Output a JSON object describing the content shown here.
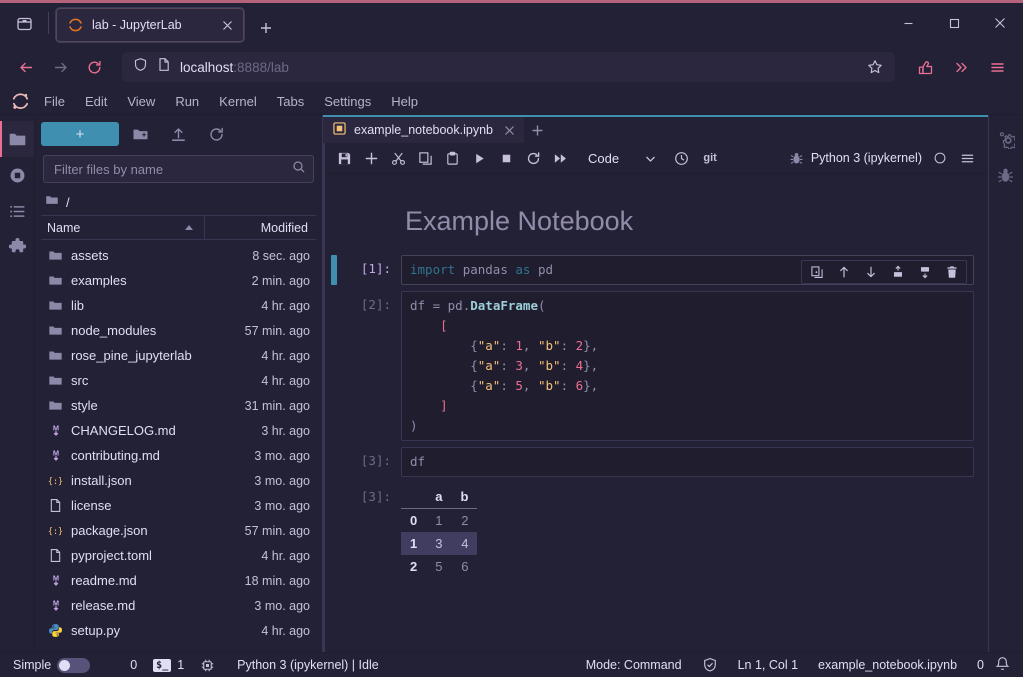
{
  "browser": {
    "tab": {
      "title": "lab - JupyterLab",
      "favicon": "jupyter-icon",
      "close": "close-icon"
    },
    "new_tab_label": "+",
    "url_display": "localhost",
    "url_rest": ":8888/lab",
    "list_all_tabs_icon": "tab-list-icon",
    "nav": {
      "back": "back-arrow-icon",
      "forward": "forward-arrow-icon",
      "reload": "reload-icon",
      "shield": "shield-icon",
      "page": "page-icon",
      "bookmark": "star-icon",
      "extensions": "extension-icon",
      "overflow": "chevron-double-right-icon",
      "menu": "hamburger-menu-icon"
    },
    "window_controls": {
      "minimize": "minimize-icon",
      "maximize": "maximize-icon",
      "close": "close-icon"
    }
  },
  "jupyter": {
    "logo": "jupyter-logo-icon",
    "menus": [
      "File",
      "Edit",
      "View",
      "Run",
      "Kernel",
      "Tabs",
      "Settings",
      "Help"
    ],
    "activity_bar": [
      {
        "name": "file-browser",
        "icon": "folder-icon",
        "active": true
      },
      {
        "name": "running-terminals",
        "icon": "running-circle-icon",
        "active": false
      },
      {
        "name": "table-of-contents",
        "icon": "list-icon",
        "active": false
      },
      {
        "name": "extension-manager",
        "icon": "puzzle-icon",
        "active": false
      }
    ],
    "right_bar": [
      {
        "name": "property-inspector",
        "icon": "gears-icon"
      },
      {
        "name": "debugger",
        "icon": "bug-icon"
      }
    ],
    "file_browser": {
      "new_launcher_label": "+",
      "toolbar": [
        "new-folder-icon",
        "upload-icon",
        "refresh-icon"
      ],
      "filter_placeholder": "Filter files by name",
      "filter_value": "",
      "search_icon": "search-icon",
      "breadcrumb": "/",
      "columns": {
        "name": "Name",
        "modified": "Modified",
        "sort": "sort-ascending-icon"
      },
      "files": [
        {
          "name": "assets",
          "modified": "8 sec. ago",
          "type": "folder"
        },
        {
          "name": "examples",
          "modified": "2 min. ago",
          "type": "folder"
        },
        {
          "name": "lib",
          "modified": "4 hr. ago",
          "type": "folder"
        },
        {
          "name": "node_modules",
          "modified": "57 min. ago",
          "type": "folder"
        },
        {
          "name": "rose_pine_jupyterlab",
          "modified": "4 hr. ago",
          "type": "folder"
        },
        {
          "name": "src",
          "modified": "4 hr. ago",
          "type": "folder"
        },
        {
          "name": "style",
          "modified": "31 min. ago",
          "type": "folder"
        },
        {
          "name": "CHANGELOG.md",
          "modified": "3 hr. ago",
          "type": "markdown"
        },
        {
          "name": "contributing.md",
          "modified": "3 mo. ago",
          "type": "markdown"
        },
        {
          "name": "install.json",
          "modified": "3 mo. ago",
          "type": "json"
        },
        {
          "name": "license",
          "modified": "3 mo. ago",
          "type": "file"
        },
        {
          "name": "package.json",
          "modified": "57 min. ago",
          "type": "json"
        },
        {
          "name": "pyproject.toml",
          "modified": "4 hr. ago",
          "type": "file"
        },
        {
          "name": "readme.md",
          "modified": "18 min. ago",
          "type": "markdown"
        },
        {
          "name": "release.md",
          "modified": "3 mo. ago",
          "type": "markdown"
        },
        {
          "name": "setup.py",
          "modified": "4 hr. ago",
          "type": "python"
        }
      ]
    },
    "notebook": {
      "tab_label": "example_notebook.ipynb",
      "tab_icon": "notebook-icon",
      "tab_close": "close-icon",
      "add_tab": "+",
      "toolbar": {
        "save": "save-icon",
        "insert": "plus-icon",
        "cut": "scissors-icon",
        "copy": "copy-icon",
        "paste": "paste-icon",
        "run": "play-icon",
        "stop": "stop-icon",
        "restart": "restart-icon",
        "restart_run_all": "fast-forward-icon",
        "cell_type": "Code",
        "cell_type_chevron": "chevron-down-icon",
        "history": "clock-icon",
        "git": "git",
        "debugger": "bug-icon",
        "kernel_name": "Python 3 (ipykernel)",
        "kernel_status": "circle-idle-icon",
        "kernel_menu": "hamburger-menu-icon"
      },
      "title": "Example Notebook",
      "cells": [
        {
          "prompt": "[1]:",
          "active": true,
          "toolbar": [
            "duplicate-icon",
            "move-up-icon",
            "move-down-icon",
            "insert-above-icon",
            "insert-below-icon",
            "delete-icon"
          ],
          "code_html": "<span class=\"k\">import</span> <span class=\"id\">pandas</span> <span class=\"k\">as</span> <span class=\"id\">pd</span>"
        },
        {
          "prompt": "[2]:",
          "active": false,
          "code_html": "<span class=\"id\">df</span> <span class=\"op\">=</span> <span class=\"id\">pd</span><span class=\"pun\">.</span><span class=\"fn\">DataFrame</span><span class=\"pun\">(</span>\n    <span class=\"br\">[</span>\n        <span class=\"pun\">{</span><span class=\"str\">\"a\"</span><span class=\"pun\">:</span> <span class=\"num\">1</span><span class=\"pun\">,</span> <span class=\"str\">\"b\"</span><span class=\"pun\">:</span> <span class=\"num\">2</span><span class=\"pun\">},</span>\n        <span class=\"pun\">{</span><span class=\"str\">\"a\"</span><span class=\"pun\">:</span> <span class=\"num\">3</span><span class=\"pun\">,</span> <span class=\"str\">\"b\"</span><span class=\"pun\">:</span> <span class=\"num\">4</span><span class=\"pun\">},</span>\n        <span class=\"pun\">{</span><span class=\"str\">\"a\"</span><span class=\"pun\">:</span> <span class=\"num\">5</span><span class=\"pun\">,</span> <span class=\"str\">\"b\"</span><span class=\"pun\">:</span> <span class=\"num\">6</span><span class=\"pun\">},</span>\n    <span class=\"br\">]</span>\n<span class=\"pun\">)</span>"
        },
        {
          "prompt": "[3]:",
          "active": false,
          "code_html": "<span class=\"id\">df</span>"
        }
      ],
      "output": {
        "prompt": "[3]:",
        "table": {
          "columns": [
            "a",
            "b"
          ],
          "index": [
            "0",
            "1",
            "2"
          ],
          "rows": [
            [
              "1",
              "2"
            ],
            [
              "3",
              "4"
            ],
            [
              "5",
              "6"
            ]
          ],
          "highlighted_row": 1
        }
      }
    },
    "status_bar": {
      "simple_label": "Simple",
      "simple_on": false,
      "kernel_count": "0",
      "terminal_badge": "$_",
      "terminal_count": "1",
      "cpu_icon": "cpu-icon",
      "kernel_status": "Python 3 (ipykernel) | Idle",
      "mode": "Mode: Command",
      "trust_icon": "trusted-shield-icon",
      "cursor": "Ln 1, Col 1",
      "filename": "example_notebook.ipynb",
      "notification_count": "0",
      "bell_icon": "bell-icon"
    }
  },
  "colors": {
    "base": "#191724",
    "surface": "#1f1d2e",
    "overlay": "#232136",
    "muted": "#6e6a86",
    "subtle": "#908caa",
    "text": "#e0def4",
    "love": "#eb6f92",
    "gold": "#f6c177",
    "rose": "#ebbcba",
    "pine": "#31748f",
    "foam": "#9ccfd8",
    "iris": "#c4a7e7",
    "accent": "#3e8fb0"
  }
}
